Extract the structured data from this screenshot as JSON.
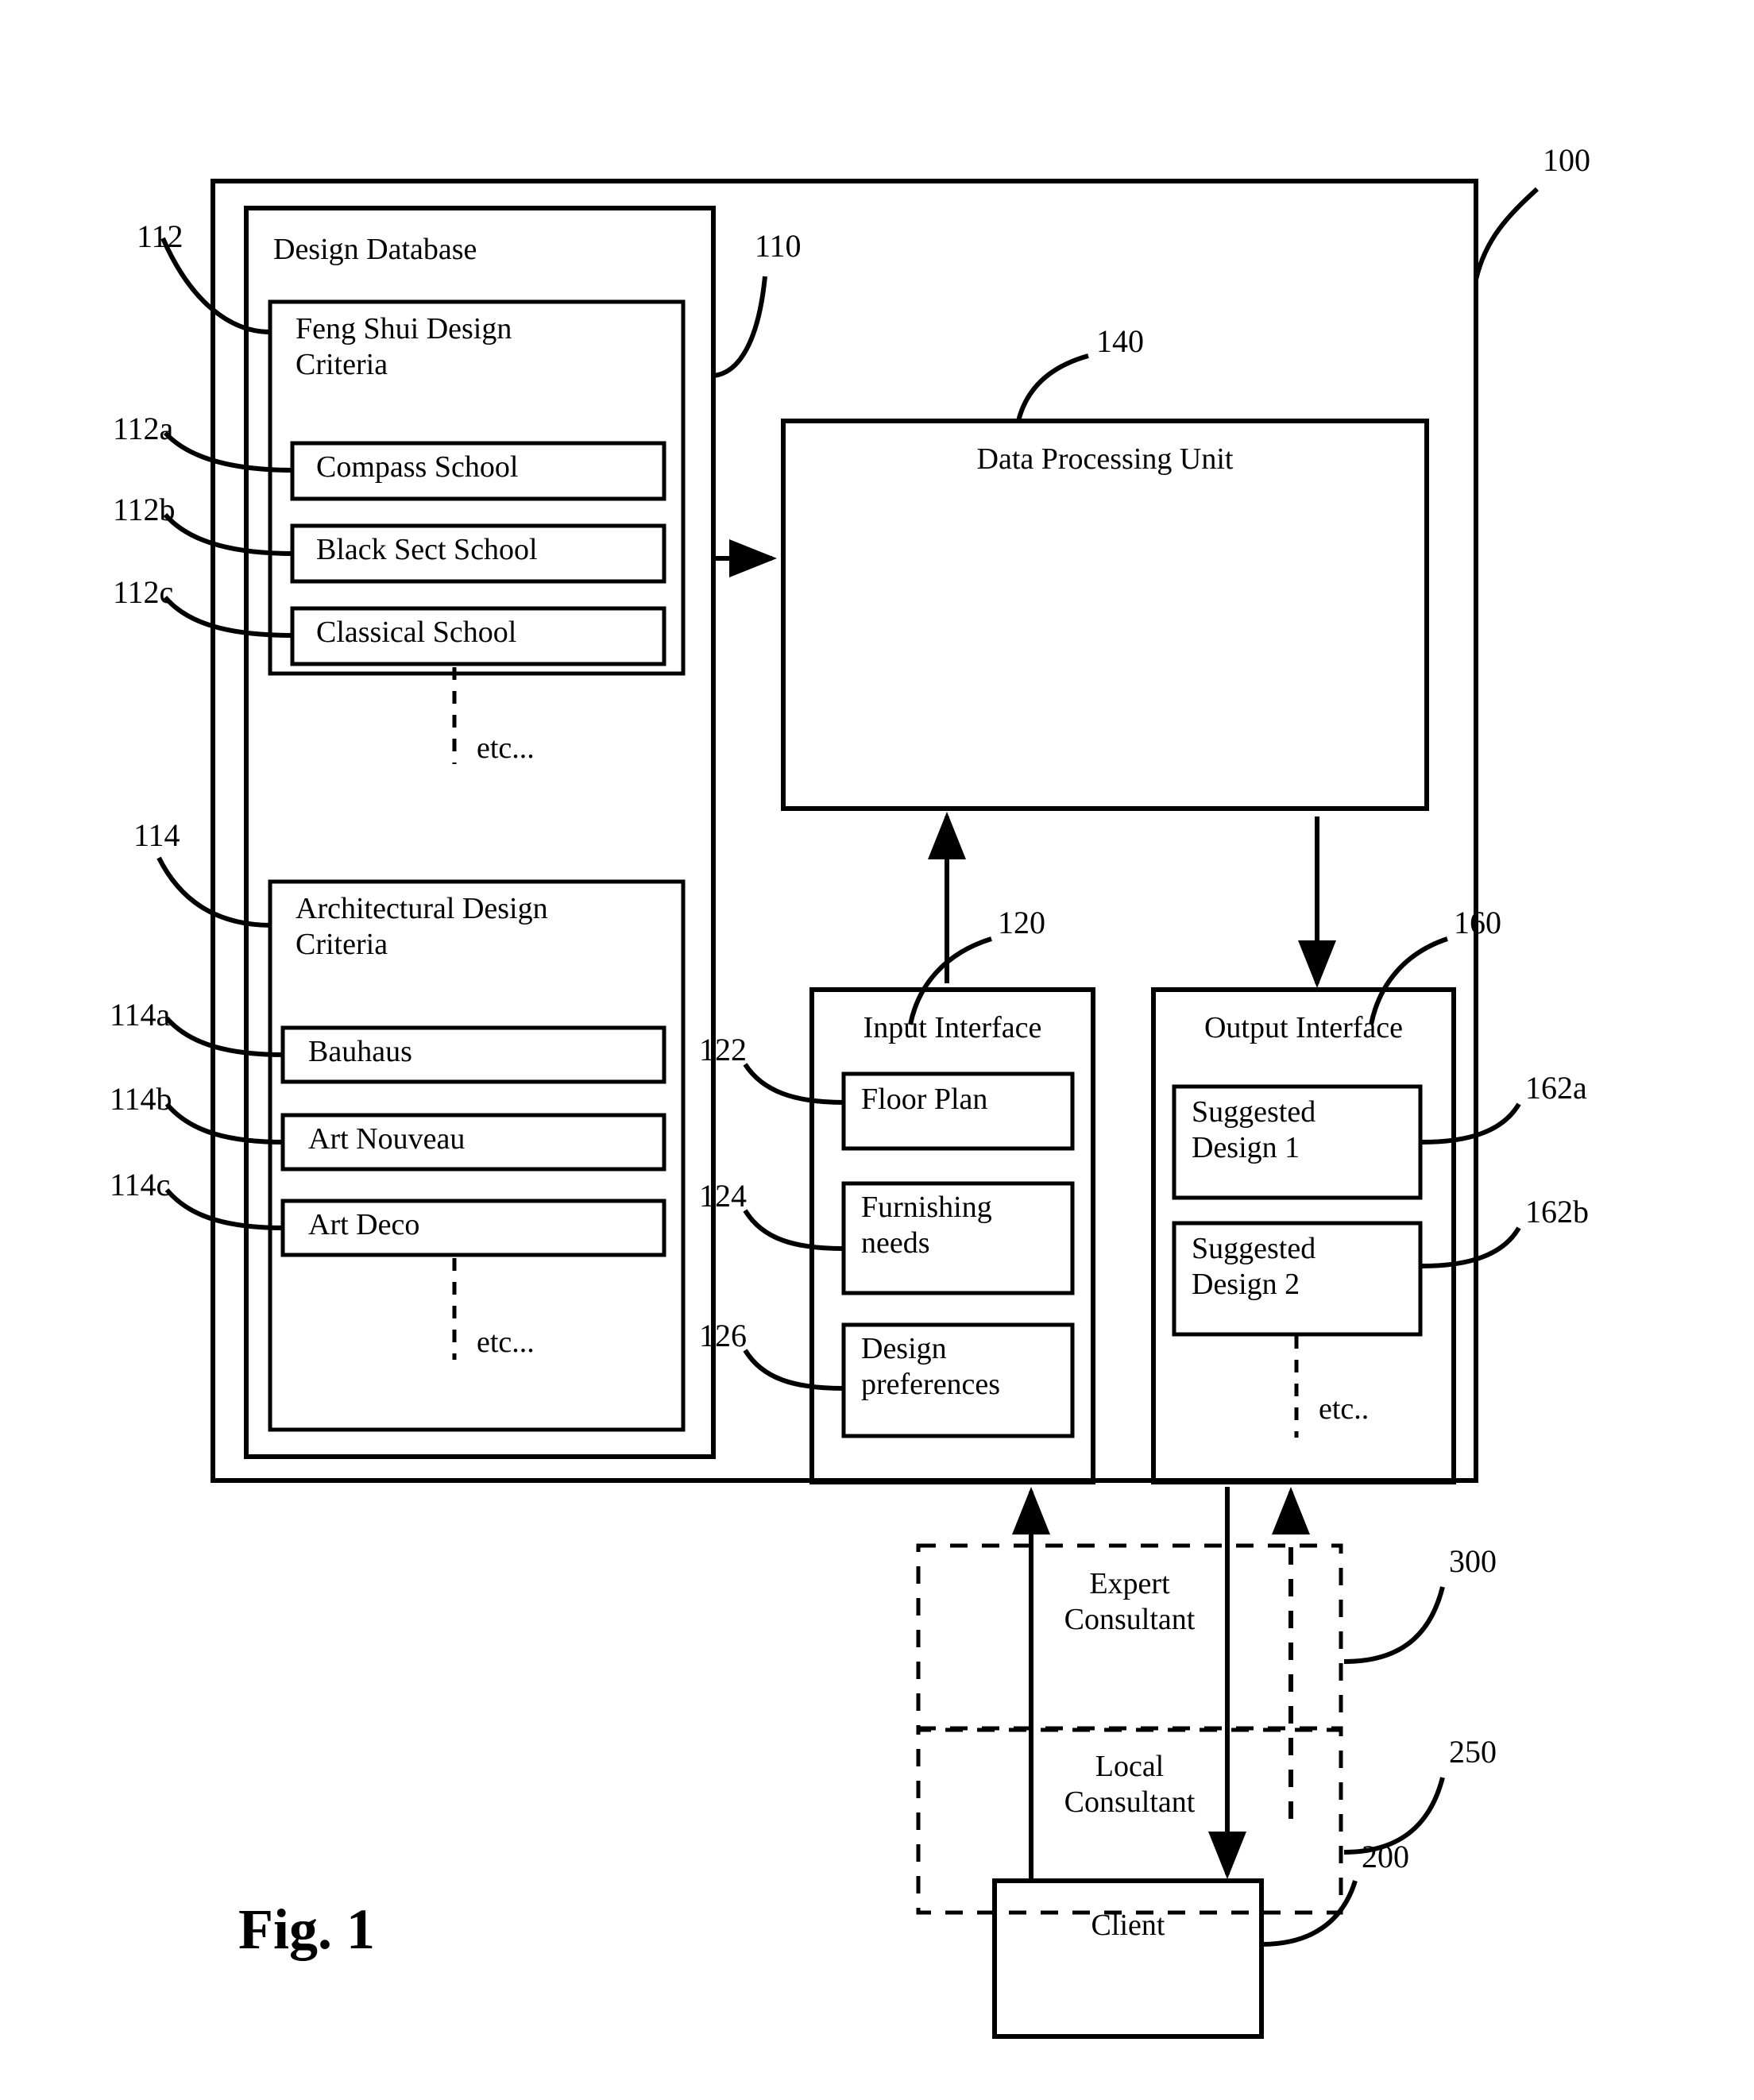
{
  "figure": {
    "caption": "Fig. 1",
    "system_ref": "100"
  },
  "system": {
    "design_database": {
      "title": "Design Database",
      "ref": "110",
      "feng_shui": {
        "title": "Feng Shui Design\nCriteria",
        "ref": "112",
        "items": [
          {
            "label": "Compass School",
            "ref": "112a"
          },
          {
            "label": "Black Sect School",
            "ref": "112b"
          },
          {
            "label": "Classical School",
            "ref": "112c"
          }
        ],
        "etc": "etc..."
      },
      "architectural": {
        "title": "Architectural Design\nCriteria",
        "ref": "114",
        "items": [
          {
            "label": "Bauhaus",
            "ref": "114a"
          },
          {
            "label": "Art Nouveau",
            "ref": "114b"
          },
          {
            "label": "Art Deco",
            "ref": "114c"
          }
        ],
        "etc": "etc..."
      }
    },
    "data_processing_unit": {
      "title": "Data Processing Unit",
      "ref": "140"
    },
    "input_interface": {
      "title": "Input Interface",
      "ref": "120",
      "items": [
        {
          "label": "Floor Plan",
          "ref": "122"
        },
        {
          "label": "Furnishing\nneeds",
          "ref": "124"
        },
        {
          "label": "Design\npreferences",
          "ref": "126"
        }
      ]
    },
    "output_interface": {
      "title": "Output Interface",
      "ref": "160",
      "items": [
        {
          "label": "Suggested\nDesign 1",
          "ref": "162a"
        },
        {
          "label": "Suggested\nDesign 2",
          "ref": "162b"
        }
      ],
      "etc": "etc.."
    }
  },
  "external": {
    "expert_consultant": {
      "label": "Expert\nConsultant",
      "ref": "300"
    },
    "local_consultant": {
      "label": "Local\nConsultant",
      "ref": "250"
    },
    "client": {
      "label": "Client",
      "ref": "200"
    }
  },
  "colors": {
    "stroke": "#000000",
    "background": "#ffffff"
  }
}
